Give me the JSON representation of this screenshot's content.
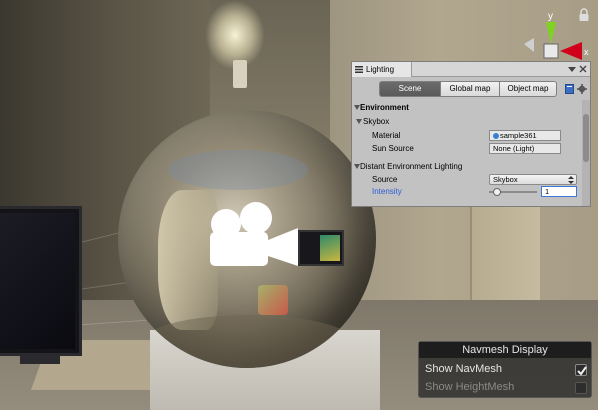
{
  "lighting_window": {
    "tab_title": "Lighting",
    "modes": [
      {
        "label": "Scene",
        "active": true
      },
      {
        "label": "Global map",
        "active": false
      },
      {
        "label": "Object map",
        "active": false
      }
    ],
    "sections": {
      "environment": "Environment",
      "skybox": "Skybox",
      "material_label": "Material",
      "material_value": "sample361",
      "sun_source_label": "Sun Source",
      "sun_source_value": "None (Light)",
      "distant_env_lighting": "Distant Environment Lighting",
      "source_label": "Source",
      "source_value": "Skybox",
      "intensity_label": "Intensity",
      "intensity_value": "1",
      "intensity_level": 0.1
    }
  },
  "gizmo": {
    "y_axis": "y",
    "x_axis": "x"
  },
  "navmesh_display": {
    "title": "Navmesh Display",
    "show_navmesh_label": "Show NavMesh",
    "show_navmesh_checked": true,
    "show_heightmesh_label": "Show HeightMesh",
    "show_heightmesh_checked": false
  },
  "colors": {
    "accent_blue": "#3b78d8",
    "intensity_label": "#2a5bd7",
    "gizmo_y": "#7ed321",
    "gizmo_x": "#d0021b"
  },
  "icons": [
    "camera-icon",
    "lock-icon",
    "hamburger-icon",
    "close-icon",
    "book-icon",
    "gear-icon",
    "checkmark-icon"
  ]
}
